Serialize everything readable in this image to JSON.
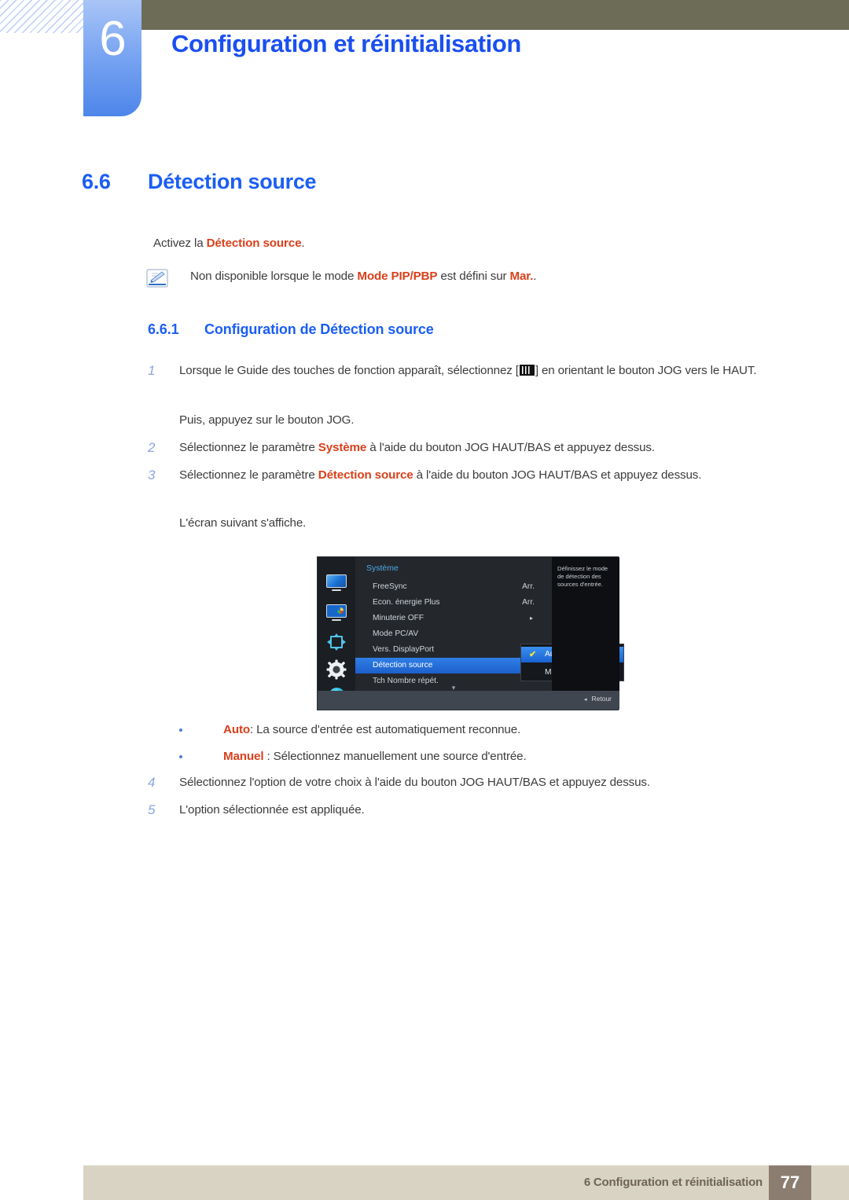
{
  "header": {
    "chapter_number": "6",
    "chapter_title": "Configuration et réinitialisation"
  },
  "section": {
    "number": "6.6",
    "title": "Détection source",
    "intro_prefix": "Activez la ",
    "intro_highlight": "Détection source",
    "intro_suffix": "."
  },
  "note": {
    "icon": "note-pencil-icon",
    "text_part1": "Non disponible lorsque le mode ",
    "text_hl1": "Mode PIP/PBP",
    "text_part2": " est défini sur ",
    "text_hl2": "Mar.",
    "text_part3": "."
  },
  "subsection": {
    "number": "6.6.1",
    "title": "Configuration de Détection source"
  },
  "steps": [
    {
      "num": "1",
      "text_a": "Lorsque le Guide des touches de fonction apparaît, sélectionnez [",
      "glyph": "menu-bars-icon",
      "text_b": "] en orientant le bouton JOG vers le HAUT.",
      "extra": "Puis, appuyez sur le bouton JOG."
    },
    {
      "num": "2",
      "text_a": "Sélectionnez le paramètre ",
      "hl": "Système",
      "text_b": " à l'aide du bouton JOG HAUT/BAS et appuyez dessus."
    },
    {
      "num": "3",
      "text_a": "Sélectionnez le paramètre ",
      "hl": "Détection source",
      "text_b": " à l'aide du bouton JOG HAUT/BAS et appuyez dessus.",
      "extra": "L'écran suivant s'affiche."
    },
    {
      "num": "4",
      "text_a": "Sélectionnez l'option de votre choix à l'aide du bouton JOG HAUT/BAS et appuyez dessus."
    },
    {
      "num": "5",
      "text_a": "L'option sélectionnée est appliquée."
    }
  ],
  "bullets": [
    {
      "hl": "Auto",
      "text": ": La source d'entrée est automatiquement reconnue."
    },
    {
      "hl": "Manuel",
      "text": " : Sélectionnez manuellement une source d'entrée."
    }
  ],
  "osd": {
    "category": "Système",
    "icons": [
      "monitor-icon",
      "picture-color-icon",
      "position-arrows-icon",
      "gear-settings-icon",
      "info-icon"
    ],
    "rows": [
      {
        "label": "FreeSync",
        "value": "Arr."
      },
      {
        "label": "Econ. énergie Plus",
        "value": "Arr."
      },
      {
        "label": "Minuterie OFF",
        "arrow": "▸"
      },
      {
        "label": "Mode PC/AV"
      },
      {
        "label": "Vers. DisplayPort"
      },
      {
        "label": "Détection source",
        "selected": true
      },
      {
        "label": "Tch Nombre répét."
      }
    ],
    "scroll_indicator": "▾",
    "submenu": [
      {
        "label": "Auto",
        "checked": true,
        "check": "✔"
      },
      {
        "label": "Manuel",
        "checked": false
      }
    ],
    "help_text": "Définissez le mode de détection des sources d'entrée.",
    "back_arrow": "◂",
    "back_label": "Retour"
  },
  "footer": {
    "text": "6 Configuration et réinitialisation",
    "page": "77"
  },
  "colors": {
    "accent_blue": "#1a5ef5",
    "highlight_orange": "#d9401b",
    "header_olive": "#6d6d57",
    "footer_beige": "#d8d3c2",
    "footer_page_brown": "#8b7d6f",
    "osd_select_blue": "#2f7fe6"
  }
}
